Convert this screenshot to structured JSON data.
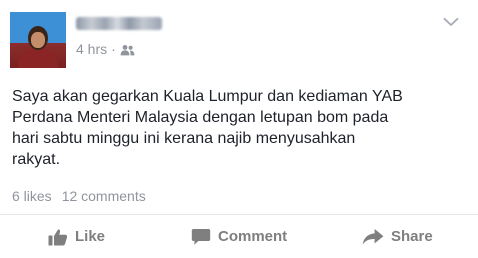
{
  "post": {
    "author": {
      "name_hidden": "",
      "avatar": "user-avatar"
    },
    "timestamp": "4 hrs",
    "separator": "·",
    "audience_icon": "friends-icon",
    "menu_icon": "chevron-down-icon",
    "text": "Saya akan gegarkan Kuala Lumpur dan kediaman YAB\nPerdana Menteri Malaysia dengan letupan bom pada\nhari sabtu minggu ini kerana najib menyusahkan\nrakyat.",
    "stats": {
      "likes": "6 likes",
      "comments": "12 comments"
    },
    "actions": {
      "like": {
        "label": "Like",
        "icon": "thumbs-up-icon"
      },
      "comment": {
        "label": "Comment",
        "icon": "comment-icon"
      },
      "share": {
        "label": "Share",
        "icon": "share-arrow-icon"
      }
    }
  },
  "colors": {
    "text_primary": "#1d2129",
    "text_secondary": "#90949c",
    "action_text": "#7f7f7f",
    "divider": "#e5e6e9",
    "background": "#ffffff"
  }
}
